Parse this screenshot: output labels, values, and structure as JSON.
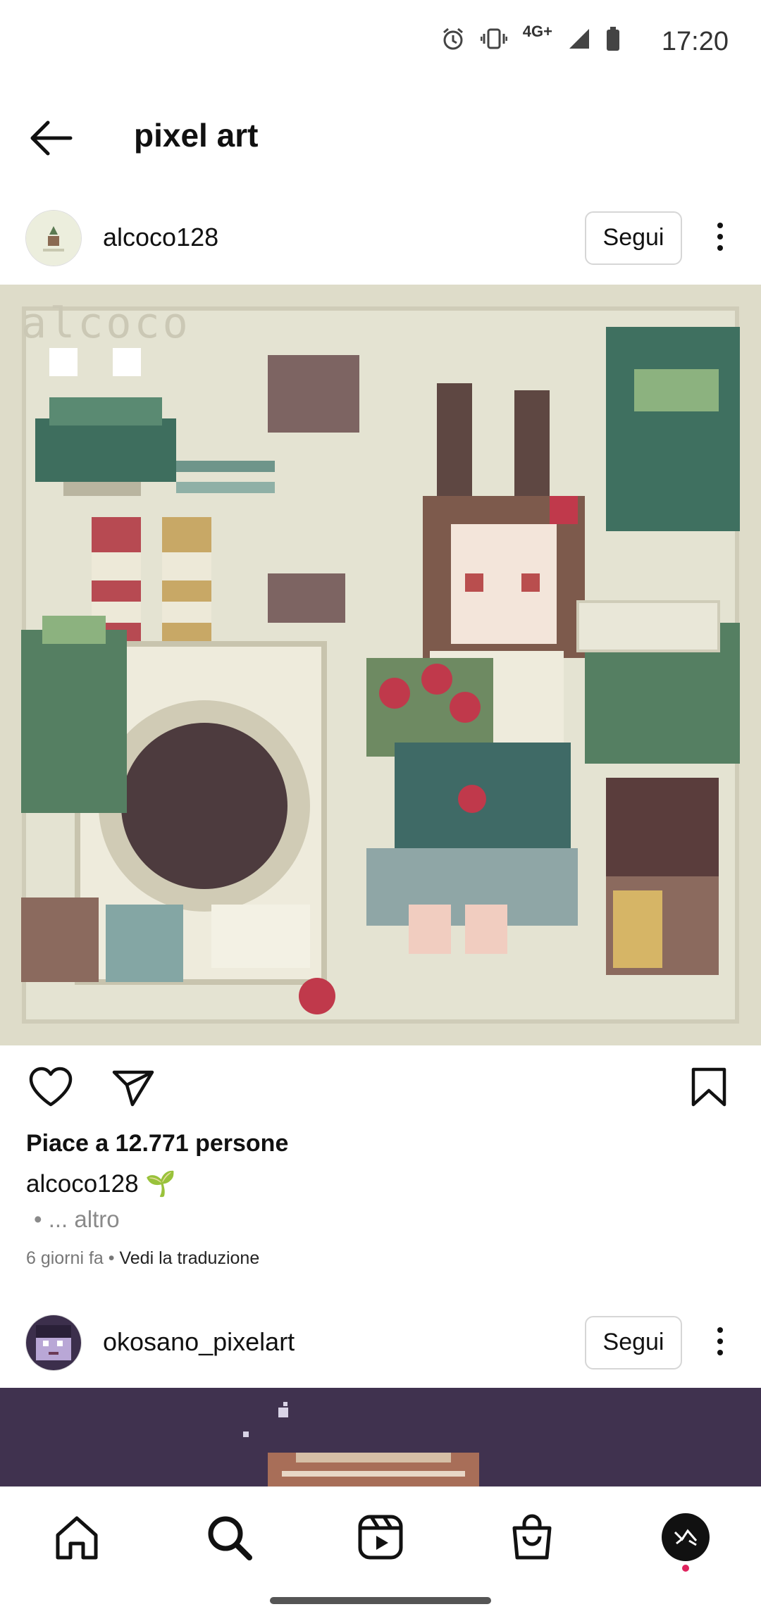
{
  "status_bar": {
    "time": "17:20",
    "network": "4G+"
  },
  "header": {
    "title": "pixel art"
  },
  "post1": {
    "username": "alcoco128",
    "follow_label": "Segui",
    "image_signature": "alcoco",
    "likes_text": "Piace a 12.771 persone",
    "caption_user": "alcoco128",
    "caption_emoji": "🌱",
    "more_text": "• ... altro",
    "time_ago": "6 giorni fa",
    "separator": "•",
    "translate_label": "Vedi la traduzione"
  },
  "post2": {
    "username": "okosano_pixelart",
    "follow_label": "Segui"
  },
  "colors": {
    "accent_dot": "#e0245e",
    "image_bg": "#dedcc9",
    "post2_bg": "#40324f"
  },
  "icons": [
    "alarm-icon",
    "vibrate-icon",
    "signal-icon",
    "battery-icon",
    "back-arrow-icon",
    "more-vertical-icon",
    "heart-icon",
    "send-icon",
    "bookmark-icon",
    "home-icon",
    "search-icon",
    "reels-icon",
    "shop-icon",
    "profile-avatar"
  ]
}
